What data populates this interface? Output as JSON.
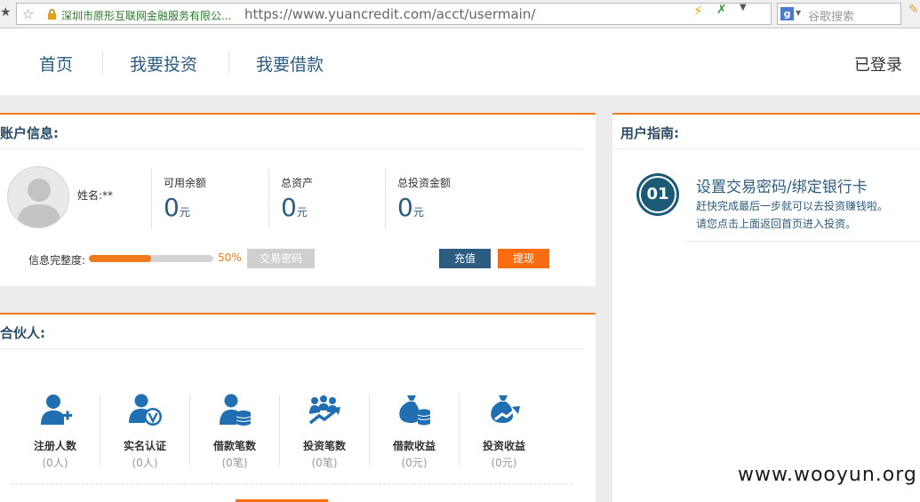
{
  "browser": {
    "site_name": "深圳市原形互联网金融服务有限公...",
    "url": "https://www.yuancredit.com/acct/usermain/",
    "search_engine_letter": "g",
    "search_placeholder": "谷歌搜索"
  },
  "nav": {
    "items": [
      "首页",
      "我要投资",
      "我要借款"
    ],
    "login_status": "已登录"
  },
  "account": {
    "title": "账户信息:",
    "name_label": "姓名:**",
    "stats": [
      {
        "label": "可用余额",
        "value": "0",
        "unit": "元"
      },
      {
        "label": "总资产",
        "value": "0",
        "unit": "元"
      },
      {
        "label": "总投资金额",
        "value": "0",
        "unit": "元"
      }
    ],
    "completeness_label": "信息完整度:",
    "completeness_percent": 50,
    "completeness_text": "50%",
    "trade_password_button": "交易密码",
    "recharge_button": "充值",
    "withdraw_button": "提现"
  },
  "partner": {
    "title": "合伙人:",
    "items": [
      {
        "label": "注册人数",
        "count": "(0人)",
        "icon": "user-plus-icon"
      },
      {
        "label": "实名认证",
        "count": "(0人)",
        "icon": "user-verified-icon"
      },
      {
        "label": "借款笔数",
        "count": "(0笔)",
        "icon": "user-coins-icon"
      },
      {
        "label": "投资笔数",
        "count": "(0笔)",
        "icon": "group-trend-icon"
      },
      {
        "label": "借款收益",
        "count": "(0元)",
        "icon": "money-bag-coins-icon"
      },
      {
        "label": "投资收益",
        "count": "(0元)",
        "icon": "money-bag-trend-icon"
      }
    ]
  },
  "guide": {
    "title": "用户指南:",
    "step_number": "01",
    "step_title": "设置交易密码/绑定银行卡",
    "step_desc_1": "赶快完成最后一步就可以去投资赚钱啦。",
    "step_desc_2": "请您点击上面返回首页进入投资。"
  },
  "watermark": "www.wooyun.org",
  "colors": {
    "accent_orange": "#f07a1a",
    "primary_blue": "#2c5d80",
    "icon_blue": "#1f6fb2"
  }
}
